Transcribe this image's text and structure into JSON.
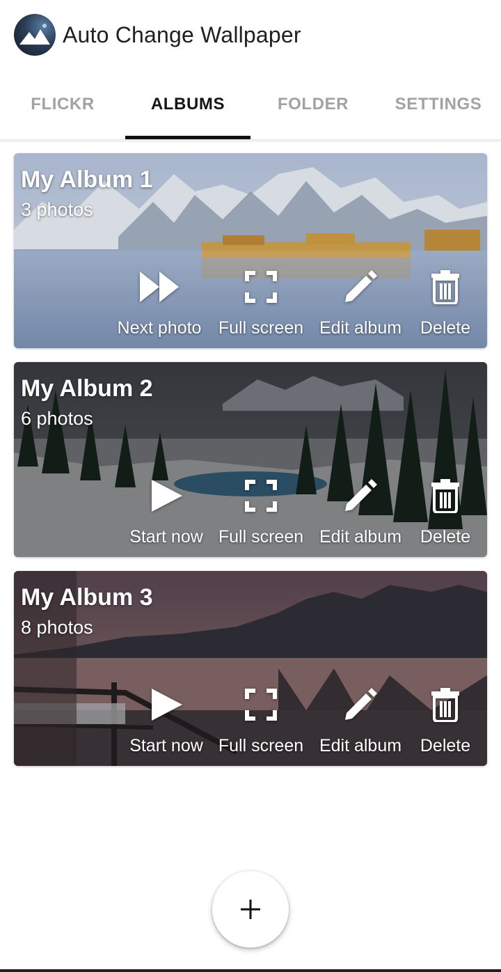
{
  "app": {
    "title": "Auto Change Wallpaper",
    "logo_icon": "mountain-logo-icon"
  },
  "tabs": [
    {
      "label": "FLICKR",
      "active": false
    },
    {
      "label": "ALBUMS",
      "active": true
    },
    {
      "label": "FOLDER",
      "active": false
    },
    {
      "label": "SETTINGS",
      "active": false
    }
  ],
  "albums": [
    {
      "title": "My Album 1",
      "count": "3 photos",
      "actions": [
        {
          "label": "Next photo",
          "icon": "fast-forward-icon"
        },
        {
          "label": "Full screen",
          "icon": "fullscreen-icon"
        },
        {
          "label": "Edit album",
          "icon": "pencil-icon"
        },
        {
          "label": "Delete",
          "icon": "trash-icon"
        }
      ]
    },
    {
      "title": "My Album 2",
      "count": "6 photos",
      "actions": [
        {
          "label": "Start now",
          "icon": "play-icon"
        },
        {
          "label": "Full screen",
          "icon": "fullscreen-icon"
        },
        {
          "label": "Edit album",
          "icon": "pencil-icon"
        },
        {
          "label": "Delete",
          "icon": "trash-icon"
        }
      ]
    },
    {
      "title": "My Album 3",
      "count": "8 photos",
      "actions": [
        {
          "label": "Start now",
          "icon": "play-icon"
        },
        {
          "label": "Full screen",
          "icon": "fullscreen-icon"
        },
        {
          "label": "Edit album",
          "icon": "pencil-icon"
        },
        {
          "label": "Delete",
          "icon": "trash-icon"
        }
      ]
    }
  ],
  "fab": {
    "icon": "plus-icon"
  },
  "colors": {
    "tab_active": "#151515",
    "tab_inactive": "#a2a2a2",
    "indicator": "#111111"
  }
}
